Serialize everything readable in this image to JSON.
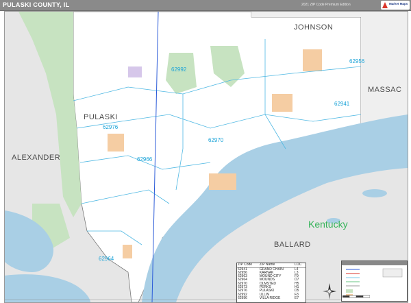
{
  "header": {
    "title": "PULASKI COUNTY, IL",
    "edition": "2021 ZIP Code Premium Edition"
  },
  "colors": {
    "county_fill": "#ffffff",
    "outside_fill": "#e8e8e8",
    "river": "#a9cfe5",
    "forest": "#c7e3c1",
    "city": "#f5cda3",
    "zip_line": "#4fb8e3",
    "title_bar": "#8a8a8a"
  },
  "map": {
    "counties": {
      "johnson": "JOHNSON",
      "massac": "MASSAC",
      "pulaski": "PULASKI",
      "alexander": "ALEXANDER",
      "ballard": "BALLARD"
    },
    "states": {
      "kentucky": "Kentucky"
    },
    "zip_labels": {
      "z62956": "62956",
      "z62992": "62992",
      "z62941": "62941",
      "z62976": "62976",
      "z62970": "62970",
      "z62966": "62966",
      "z62964": "62964"
    }
  },
  "legend": {
    "headers": [
      "ZIP Code",
      "ZIP Name",
      "LOC"
    ],
    "rows": [
      [
        "62941",
        "GRAND CHAIN",
        "L4"
      ],
      [
        "62956",
        "KARNAK",
        "L3"
      ],
      [
        "62963",
        "MOUND CITY",
        "F9"
      ],
      [
        "62964",
        "MOUNDS",
        "D7"
      ],
      [
        "62970",
        "OLMSTED",
        "H5"
      ],
      [
        "62973",
        "PERKS",
        "H1"
      ],
      [
        "62976",
        "PULASKI",
        "D5"
      ],
      [
        "62992",
        "ULLIN",
        "F3"
      ],
      [
        "62996",
        "VILLA RIDGE",
        "E7"
      ]
    ]
  },
  "brand": {
    "name": "Market Maps"
  }
}
